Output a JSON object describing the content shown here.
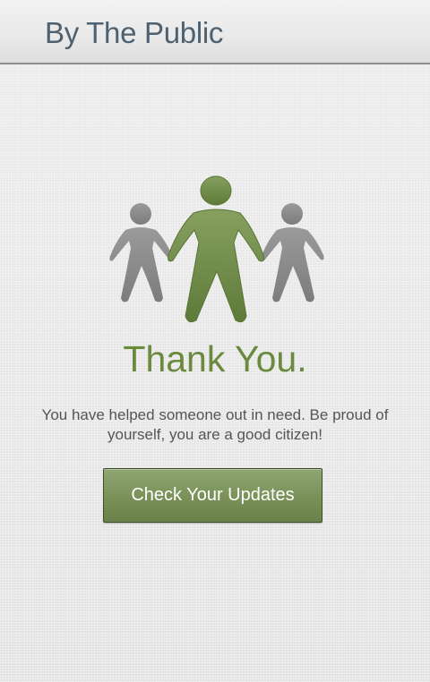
{
  "header": {
    "title": "By The Public"
  },
  "hero": {
    "icon": "people-group-icon",
    "colors": {
      "center_figure": "#6f8c48",
      "side_figures": "#8a8a8a"
    }
  },
  "main": {
    "heading": "Thank You.",
    "message": "You have helped someone out in need. Be proud of yourself, you are a good citizen!",
    "button_label": "Check Your Updates"
  },
  "theme": {
    "accent": "#6a8a3e",
    "title_color": "#4d6170",
    "button_top": "#90a673",
    "button_bottom": "#6a8149"
  }
}
